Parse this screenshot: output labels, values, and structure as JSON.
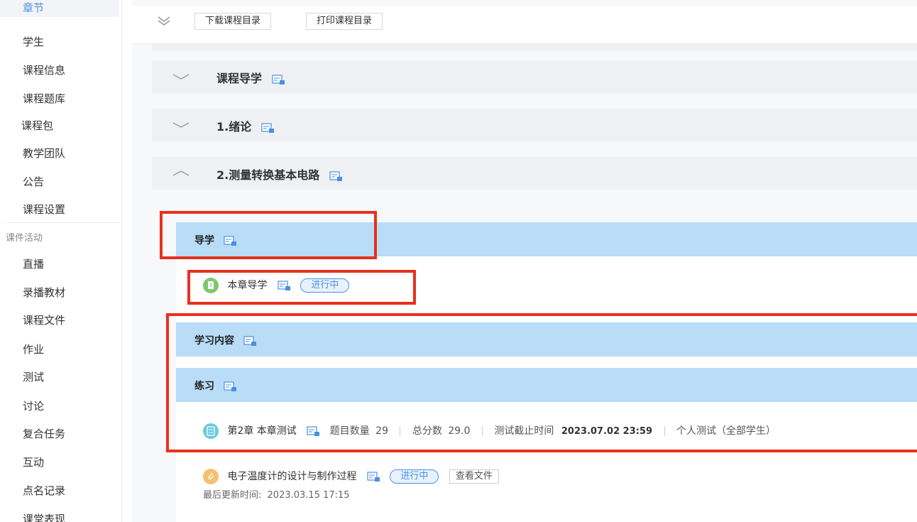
{
  "sidebar": {
    "items": [
      {
        "label": "章节"
      },
      {
        "label": "学生"
      },
      {
        "label": "课程信息"
      },
      {
        "label": "课程题库"
      },
      {
        "label": "课程包"
      },
      {
        "label": "教学团队"
      },
      {
        "label": "公告"
      },
      {
        "label": "课程设置"
      }
    ],
    "section_label": "课件活动",
    "activity_items": [
      {
        "label": "直播"
      },
      {
        "label": "录播教材"
      },
      {
        "label": "课程文件"
      },
      {
        "label": "作业"
      },
      {
        "label": "测试"
      },
      {
        "label": "讨论"
      },
      {
        "label": "复合任务"
      },
      {
        "label": "互动"
      },
      {
        "label": "点名记录"
      },
      {
        "label": "课堂表现"
      }
    ]
  },
  "toolbar": {
    "download_label": "下载课程目录",
    "print_label": "打印课程目录"
  },
  "chapters": [
    {
      "title": "课程导学"
    },
    {
      "title": "1.绪论"
    },
    {
      "title": "2.测量转换基本电路"
    }
  ],
  "sections": {
    "guide": {
      "title": "导学",
      "item": {
        "title": "本章导学",
        "status": "进行中"
      }
    },
    "content": {
      "title": "学习内容"
    },
    "practice": {
      "title": "练习",
      "test": {
        "title": "第2章 本章测试",
        "count_label": "题目数量",
        "count_value": "29",
        "score_label": "总分数",
        "score_value": "29.0",
        "deadline_label": "测试截止时间",
        "deadline_value": "2023.07.02 23:59",
        "scope": "个人测试（全部学生）"
      },
      "file": {
        "title": "电子温度计的设计与制作过程",
        "status": "进行中",
        "view_label": "查看文件",
        "updated_label": "最后更新时间:",
        "updated_value": "2023.03.15 17:15"
      }
    }
  },
  "colors": {
    "section_bar": "#b9dcf7",
    "chapter_bar": "#eef0f3",
    "accent_blue": "#4a90e2",
    "highlight_red": "#e8301e",
    "icon_green": "#7cc96b",
    "icon_teal": "#6cc9e0",
    "icon_orange": "#f5c072"
  }
}
